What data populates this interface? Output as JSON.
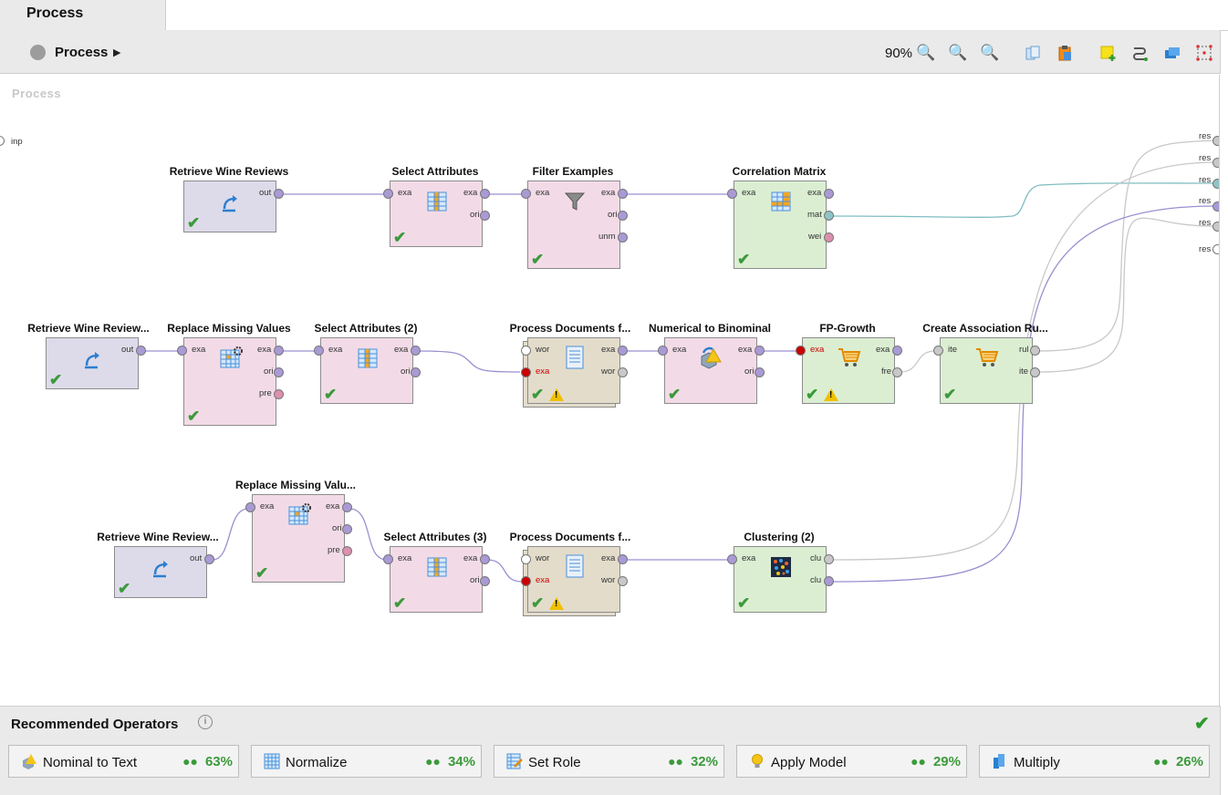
{
  "tab": {
    "label": "Process"
  },
  "toolbar": {
    "breadcrumb": "Process",
    "zoom": "90%"
  },
  "canvas": {
    "title": "Process",
    "inp_label": "inp",
    "res_labels": [
      "res",
      "res",
      "res",
      "res",
      "res",
      "res"
    ]
  },
  "row1": {
    "retrieve": {
      "title": "Retrieve Wine Reviews",
      "out": "out"
    },
    "select": {
      "title": "Select Attributes",
      "in": "exa",
      "out1": "exa",
      "out2": "ori"
    },
    "filter": {
      "title": "Filter Examples",
      "in": "exa",
      "out1": "exa",
      "out2": "ori",
      "out3": "unm"
    },
    "corr": {
      "title": "Correlation Matrix",
      "in": "exa",
      "out1": "exa",
      "out2": "mat",
      "out3": "wei"
    }
  },
  "row2": {
    "retrieve": {
      "title": "Retrieve Wine Review...",
      "out": "out"
    },
    "replace": {
      "title": "Replace Missing Values",
      "in": "exa",
      "out1": "exa",
      "out2": "ori",
      "out3": "pre"
    },
    "select": {
      "title": "Select Attributes (2)",
      "in": "exa",
      "out1": "exa",
      "out2": "ori"
    },
    "procdocs": {
      "title": "Process Documents f...",
      "in1": "wor",
      "in2": "exa",
      "out1": "exa",
      "out2": "wor"
    },
    "num2bin": {
      "title": "Numerical to Binominal",
      "in": "exa",
      "out1": "exa",
      "out2": "ori"
    },
    "fpgrowth": {
      "title": "FP-Growth",
      "in": "exa",
      "out1": "exa",
      "out2": "fre"
    },
    "assoc": {
      "title": "Create Association Ru...",
      "in": "ite",
      "out1": "rul",
      "out2": "ite"
    }
  },
  "row3": {
    "retrieve": {
      "title": "Retrieve Wine Review...",
      "out": "out"
    },
    "replace": {
      "title": "Replace Missing Valu...",
      "in": "exa",
      "out1": "exa",
      "out2": "ori",
      "out3": "pre"
    },
    "select": {
      "title": "Select Attributes (3)",
      "in": "exa",
      "out1": "exa",
      "out2": "ori"
    },
    "procdocs": {
      "title": "Process Documents f...",
      "in1": "wor",
      "in2": "exa",
      "out1": "exa",
      "out2": "wor"
    },
    "cluster": {
      "title": "Clustering (2)",
      "in": "exa",
      "out1": "clu",
      "out2": "clu"
    }
  },
  "recommended": {
    "title": "Recommended Operators",
    "items": [
      {
        "label": "Nominal to Text",
        "pct": "63%"
      },
      {
        "label": "Normalize",
        "pct": "34%"
      },
      {
        "label": "Set Role",
        "pct": "32%"
      },
      {
        "label": "Apply Model",
        "pct": "29%"
      },
      {
        "label": "Multiply",
        "pct": "26%"
      }
    ]
  },
  "colors": {
    "retrieve": "#dddbea",
    "transform": "#f2dbe7",
    "document": "#e3dccb",
    "model": "#dbeed2",
    "check": "#3b9a3b"
  }
}
